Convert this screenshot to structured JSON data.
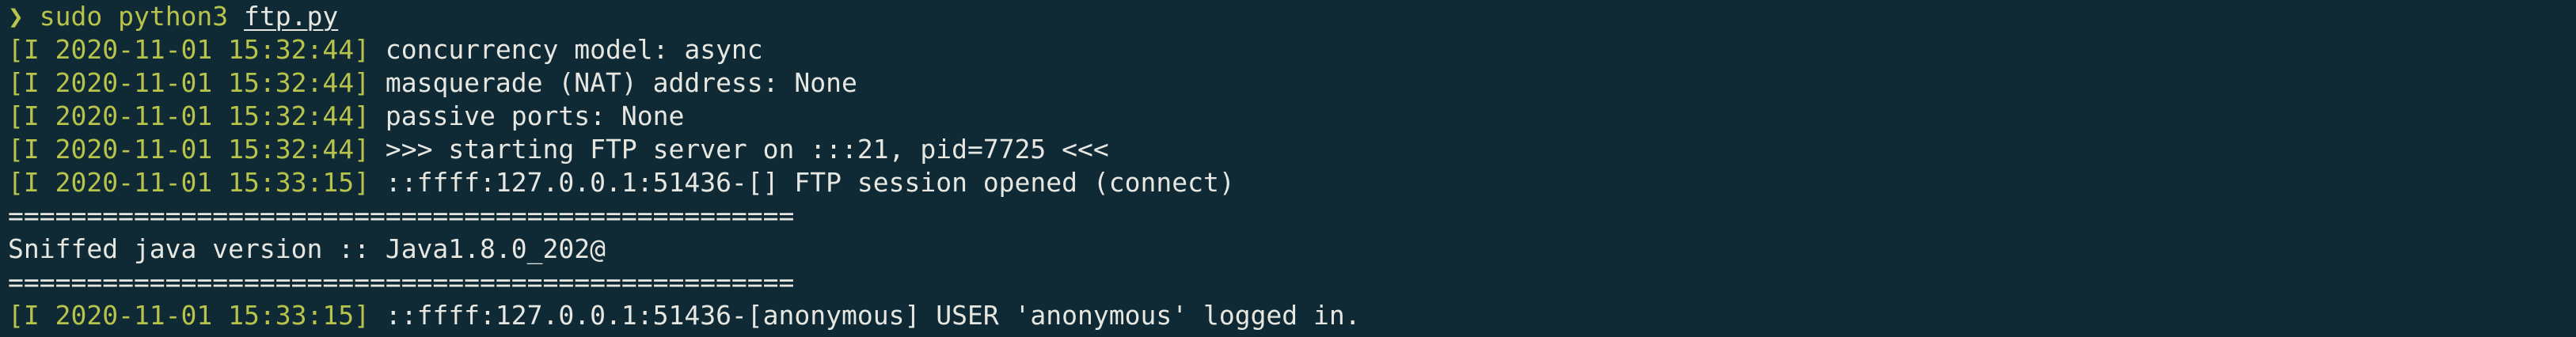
{
  "prompt": {
    "symbol": "❯",
    "command": "sudo python3",
    "argument": "ftp.py"
  },
  "lines": [
    {
      "kind": "log",
      "prefix": "[I 2020-11-01 15:32:44]",
      "text": "concurrency model: async"
    },
    {
      "kind": "log",
      "prefix": "[I 2020-11-01 15:32:44]",
      "text": "masquerade (NAT) address: None"
    },
    {
      "kind": "log",
      "prefix": "[I 2020-11-01 15:32:44]",
      "text": "passive ports: None"
    },
    {
      "kind": "log",
      "prefix": "[I 2020-11-01 15:32:44]",
      "text": ">>> starting FTP server on :::21, pid=7725 <<<"
    },
    {
      "kind": "log",
      "prefix": "[I 2020-11-01 15:33:15]",
      "text": "::ffff:127.0.0.1:51436-[] FTP session opened (connect)"
    },
    {
      "kind": "plain",
      "text": "=================================================="
    },
    {
      "kind": "plain",
      "text": "Sniffed java version :: Java1.8.0_202@"
    },
    {
      "kind": "plain",
      "text": "=================================================="
    },
    {
      "kind": "log",
      "prefix": "[I 2020-11-01 15:33:15]",
      "text": "::ffff:127.0.0.1:51436-[anonymous] USER 'anonymous' logged in."
    }
  ],
  "colors": {
    "background": "#0f2a34",
    "foreground": "#e7e7e2",
    "accent": "#b7c34b"
  }
}
